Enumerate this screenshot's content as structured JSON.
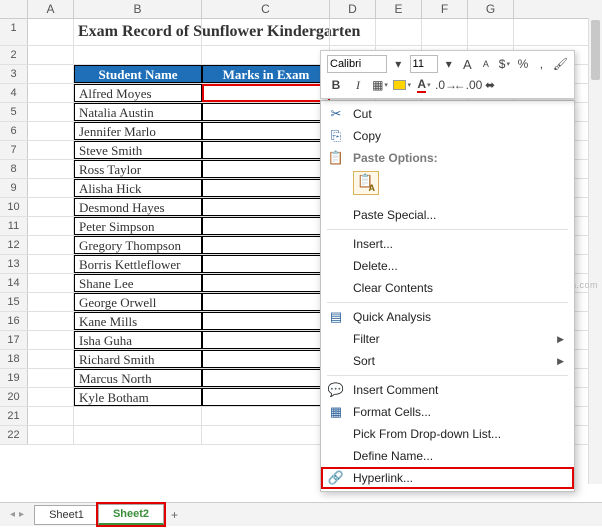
{
  "columns": [
    "A",
    "B",
    "C",
    "D",
    "E",
    "F",
    "G"
  ],
  "title": "Exam Record of Sunflower Kindergarten",
  "table": {
    "headers": [
      "Student Name",
      "Marks in Exam"
    ],
    "rows": [
      "Alfred Moyes",
      "Natalia Austin",
      "Jennifer Marlo",
      "Steve Smith",
      "Ross Taylor",
      "Alisha Hick",
      "Desmond Hayes",
      "Peter Simpson",
      "Gregory Thompson",
      "Borris Kettleflower",
      "Shane Lee",
      "George Orwell",
      "Kane Mills",
      "Isha Guha",
      "Richard Smith",
      "Marcus North",
      "Kyle Botham"
    ]
  },
  "mini_toolbar": {
    "font": "Calibri",
    "size": "11",
    "increase": "A",
    "decrease": "A"
  },
  "context_menu": {
    "cut": "Cut",
    "copy": "Copy",
    "paste_options": "Paste Options:",
    "paste_special": "Paste Special...",
    "insert": "Insert...",
    "delete": "Delete...",
    "clear": "Clear Contents",
    "quick_analysis": "Quick Analysis",
    "filter": "Filter",
    "sort": "Sort",
    "insert_comment": "Insert Comment",
    "format_cells": "Format Cells...",
    "dropdown": "Pick From Drop-down List...",
    "define_name": "Define Name...",
    "hyperlink": "Hyperlink..."
  },
  "sheets": {
    "s1": "Sheet1",
    "s2": "Sheet2",
    "add": "+"
  },
  "watermark": "wsxdn.com"
}
